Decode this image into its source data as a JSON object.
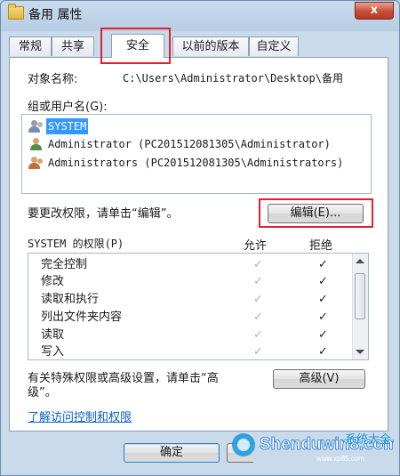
{
  "window": {
    "title": "备用 属性",
    "close_label": "x"
  },
  "tabs": [
    {
      "label": "常规"
    },
    {
      "label": "共享"
    },
    {
      "label": "安全"
    },
    {
      "label": "以前的版本"
    },
    {
      "label": "自定义"
    }
  ],
  "object": {
    "label": "对象名称:",
    "value": "C:\\Users\\Administrator\\Desktop\\备用"
  },
  "groups": {
    "label": "组或用户名(G):",
    "items": [
      {
        "name": "SYSTEM"
      },
      {
        "name": "Administrator (PC201512081305\\Administrator)"
      },
      {
        "name": "Administrators (PC201512081305\\Administrators)"
      }
    ]
  },
  "change_prompt": "要更改权限，请单击“编辑”。",
  "edit_button": "编辑(E)...",
  "permissions": {
    "title": "SYSTEM 的权限(P)",
    "allow_header": "允许",
    "deny_header": "拒绝",
    "rows": [
      {
        "name": "完全控制",
        "allow": "✓",
        "deny": "✓"
      },
      {
        "name": "修改",
        "allow": "✓",
        "deny": "✓"
      },
      {
        "name": "读取和执行",
        "allow": "✓",
        "deny": "✓"
      },
      {
        "name": "列出文件夹内容",
        "allow": "✓",
        "deny": "✓"
      },
      {
        "name": "读取",
        "allow": "✓",
        "deny": "✓"
      },
      {
        "name": "写入",
        "allow": "✓",
        "deny": "✓"
      }
    ]
  },
  "special_text_line1": "有关特殊权限或高级设置，请单击“高",
  "special_text_line2": "级”。",
  "advanced_button": "高级(V)",
  "learn_link": "了解访问控制和权限",
  "ok_button": "确定",
  "watermark": {
    "main": "Shenduwin8.com",
    "sub": "www.xp85.com",
    "cn": "系统大全"
  },
  "colors": {
    "selection": "#3399ff",
    "highlight_border": "#e0202a",
    "link": "#0a5ec8"
  }
}
